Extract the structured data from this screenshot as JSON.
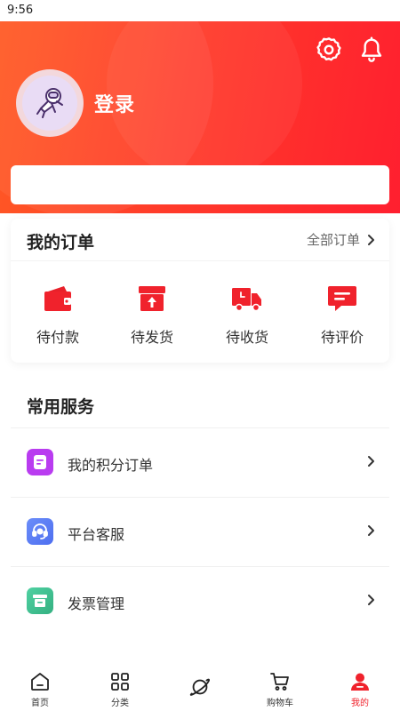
{
  "status_bar": {
    "time": "9:56"
  },
  "header": {
    "login_label": "登录"
  },
  "orders": {
    "title": "我的订单",
    "all_label": "全部订单",
    "items": [
      {
        "label": "待付款",
        "icon": "wallet-icon"
      },
      {
        "label": "待发货",
        "icon": "box-upload-icon"
      },
      {
        "label": "待收货",
        "icon": "truck-icon"
      },
      {
        "label": "待评价",
        "icon": "comment-icon"
      }
    ]
  },
  "services": {
    "title": "常用服务",
    "items": [
      {
        "label": "我的积分订单",
        "icon": "points-order-icon",
        "color": "#b93cf0"
      },
      {
        "label": "平台客服",
        "icon": "headset-icon",
        "color": "#5a7cf7"
      },
      {
        "label": "发票管理",
        "icon": "invoice-icon",
        "color": "#3fbf92"
      }
    ]
  },
  "tabbar": {
    "items": [
      {
        "label": "首页",
        "icon": "home-icon"
      },
      {
        "label": "分类",
        "icon": "grid-icon"
      },
      {
        "label": "",
        "icon": "planet-icon"
      },
      {
        "label": "购物车",
        "icon": "cart-icon"
      },
      {
        "label": "我的",
        "icon": "user-icon"
      }
    ],
    "active_color": "#f0222c"
  },
  "colors": {
    "accent": "#f0222c",
    "header_start": "#ff5a24",
    "header_end": "#ff1f2f"
  }
}
